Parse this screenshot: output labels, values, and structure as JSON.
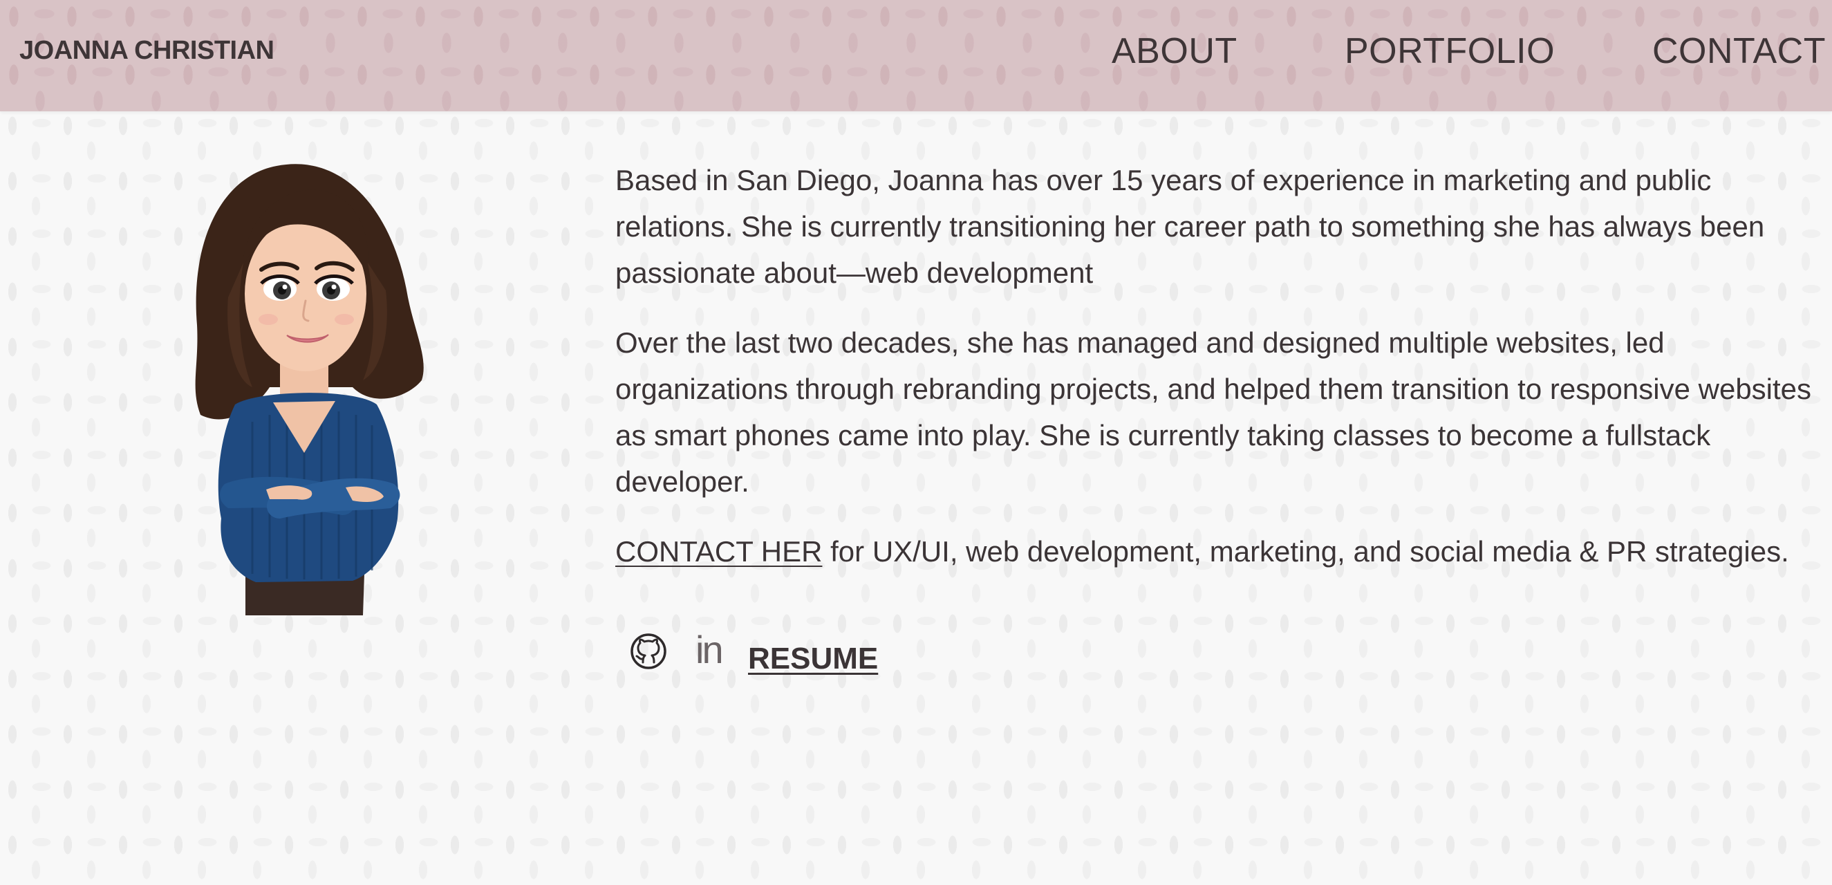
{
  "header": {
    "brand": "JOANNA CHRISTIAN",
    "nav": {
      "about": "ABOUT",
      "portfolio": "PORTFOLIO",
      "contact": "CONTACT"
    }
  },
  "bio": {
    "paragraph1": "Based in San Diego, Joanna has over 15 years of experience in marketing and public relations. She is currently transitioning her career path to something she has always been passionate about—web development",
    "paragraph2": "Over the last two decades, she has managed and designed multiple websites, led organizations through rebranding projects, and helped them transition to responsive websites as smart phones came into play. She is currently taking classes to become a fullstack developer.",
    "contact_link": "CONTACT HER",
    "contact_rest": " for UX/UI, web development, marketing, and social media & PR strategies."
  },
  "social": {
    "github_icon": "github-icon",
    "linkedin_icon": "in",
    "resume_label": "RESUME"
  },
  "colors": {
    "header_bg": "#d9c3c6",
    "text": "#3b3436",
    "page_bg": "#f8f8f8",
    "sweater": "#1f4a80",
    "hair": "#3b2418"
  }
}
